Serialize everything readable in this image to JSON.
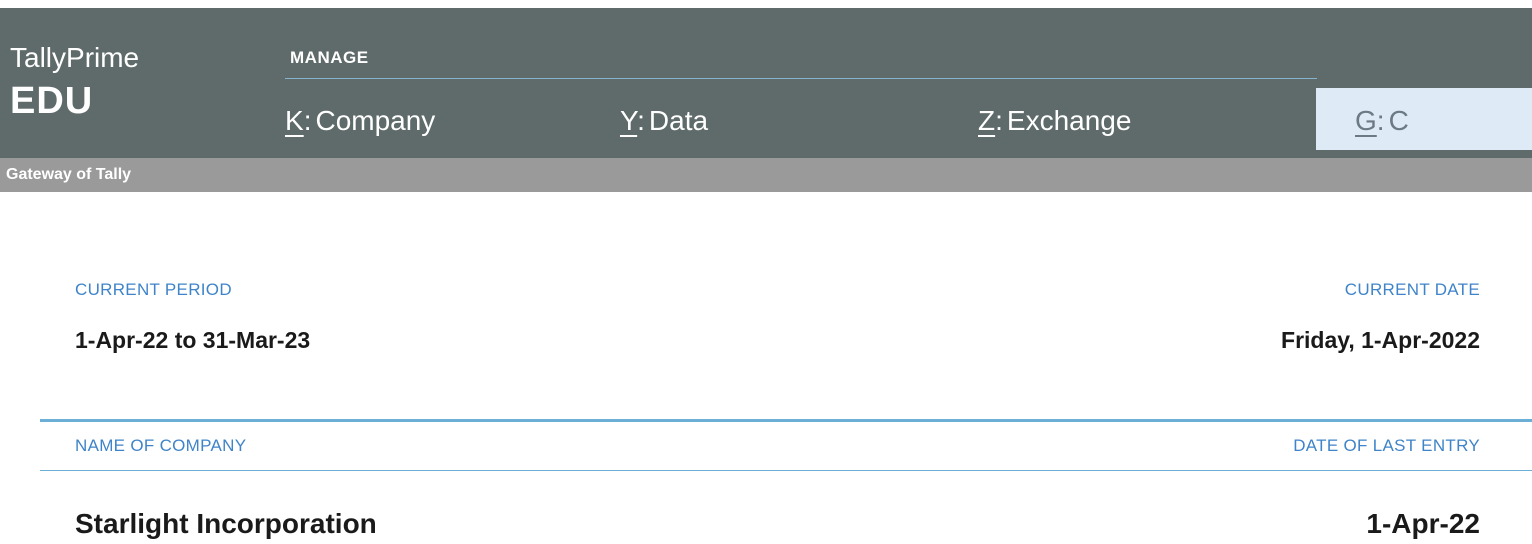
{
  "app": {
    "name": "TallyPrime",
    "edition": "EDU"
  },
  "menu": {
    "section_label": "MANAGE",
    "items": [
      {
        "key": "K",
        "label": "Company"
      },
      {
        "key": "Y",
        "label": "Data"
      },
      {
        "key": "Z",
        "label": "Exchange"
      }
    ],
    "gateway_button": {
      "key": "G",
      "label": "C"
    }
  },
  "breadcrumb": "Gateway of Tally",
  "current_period": {
    "label": "CURRENT PERIOD",
    "value": "1-Apr-22 to 31-Mar-23"
  },
  "current_date": {
    "label": "CURRENT DATE",
    "value": "Friday, 1-Apr-2022"
  },
  "company_table": {
    "headers": {
      "name": "NAME OF COMPANY",
      "last_entry": "DATE OF LAST ENTRY"
    },
    "rows": [
      {
        "name": "Starlight Incorporation",
        "last_entry": "1-Apr-22"
      }
    ]
  },
  "colors": {
    "header_bg": "#5f6b6a",
    "breadcrumb_bg": "#9a9a9a",
    "label_blue": "#3f84c9",
    "separator": "#6baed6",
    "gateway_bg": "#deebf7"
  }
}
